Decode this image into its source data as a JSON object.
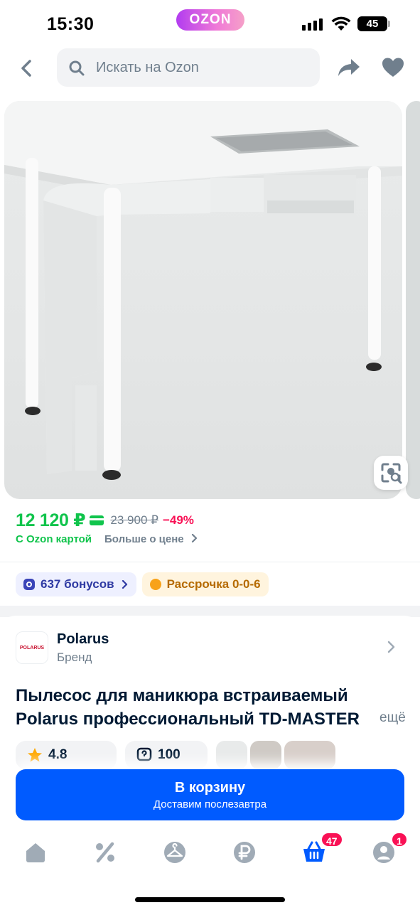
{
  "status_bar": {
    "time": "15:30",
    "ozon_badge": "OZON",
    "battery": "45",
    "icons": [
      "signal-icon",
      "wifi-icon",
      "battery-icon"
    ]
  },
  "top_bar": {
    "search_placeholder": "Искать на Ozon",
    "icons": [
      "back-arrow-icon",
      "search-icon",
      "share-icon",
      "heart-icon"
    ]
  },
  "gallery": {
    "image": "product-photo-manicure-table-with-built-in-vacuum",
    "visual_search_icon": "visual-search-icon"
  },
  "price": {
    "current": "12 120 ₽",
    "old": "23 900 ₽",
    "discount": "−49%",
    "with_card": "С Ozon картой",
    "more_about_price": "Больше о цене"
  },
  "chips": {
    "bonus": "637 бонусов",
    "installment": "Рассрочка 0-0-6"
  },
  "brand": {
    "logo_text": "POLARUS",
    "name": "Polarus",
    "label": "Бренд"
  },
  "product": {
    "title": "Пылесос для маникюра встраиваемый Polarus профессиональный TD-MASTER",
    "more": "ещё",
    "rating": "4.8",
    "questions": "100"
  },
  "cart_button": {
    "label": "В корзину",
    "sublabel": "Доставим послезавтра"
  },
  "tab_bar": {
    "tabs": [
      "home-icon",
      "percent-icon",
      "hanger-icon",
      "ruble-icon",
      "basket-icon",
      "profile-icon"
    ],
    "cart_badge": "47",
    "profile_badge": "1"
  },
  "colors": {
    "brand_blue": "#005bff",
    "price_green": "#10c44c",
    "discount_red": "#f91155",
    "muted": "#707f8d"
  }
}
